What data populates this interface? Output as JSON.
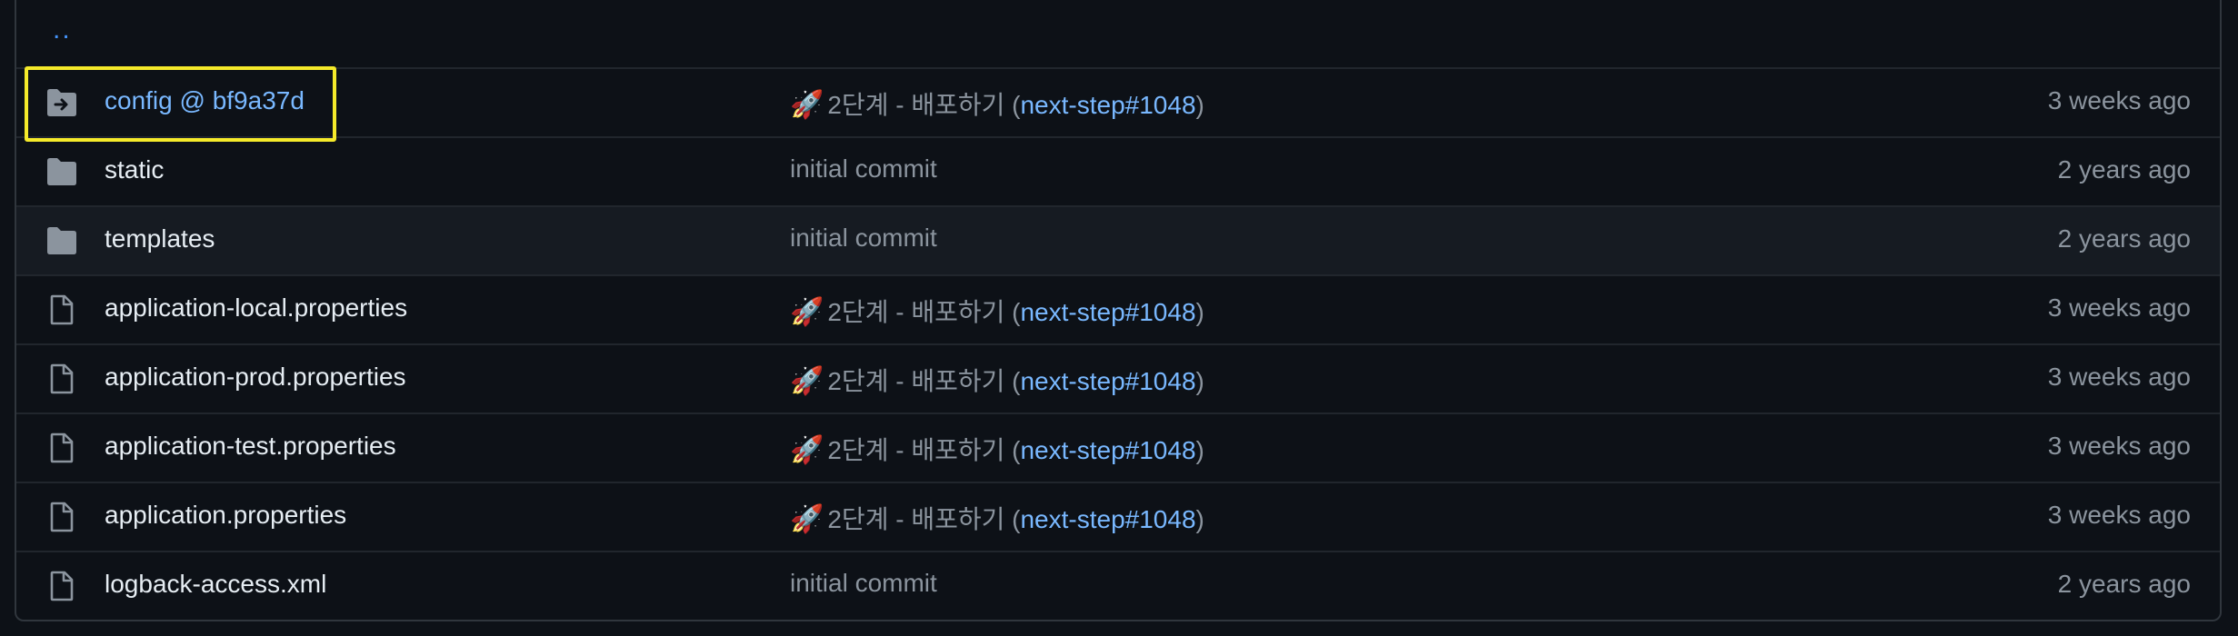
{
  "updir_label": "..",
  "rows": [
    {
      "type": "submodule",
      "name": "config @ bf9a37d",
      "commit_prefix": "2단계 - 배포하기 (",
      "commit_link": "next-step#1048",
      "commit_suffix": ")",
      "age": "3 weeks ago",
      "rocket": true
    },
    {
      "type": "folder",
      "name": "static",
      "commit_prefix": "initial commit",
      "commit_link": "",
      "commit_suffix": "",
      "age": "2 years ago",
      "rocket": false
    },
    {
      "type": "folder",
      "name": "templates",
      "commit_prefix": "initial commit",
      "commit_link": "",
      "commit_suffix": "",
      "age": "2 years ago",
      "rocket": false
    },
    {
      "type": "file",
      "name": "application-local.properties",
      "commit_prefix": "2단계 - 배포하기 (",
      "commit_link": "next-step#1048",
      "commit_suffix": ")",
      "age": "3 weeks ago",
      "rocket": true
    },
    {
      "type": "file",
      "name": "application-prod.properties",
      "commit_prefix": "2단계 - 배포하기 (",
      "commit_link": "next-step#1048",
      "commit_suffix": ")",
      "age": "3 weeks ago",
      "rocket": true
    },
    {
      "type": "file",
      "name": "application-test.properties",
      "commit_prefix": "2단계 - 배포하기 (",
      "commit_link": "next-step#1048",
      "commit_suffix": ")",
      "age": "3 weeks ago",
      "rocket": true
    },
    {
      "type": "file",
      "name": "application.properties",
      "commit_prefix": "2단계 - 배포하기 (",
      "commit_link": "next-step#1048",
      "commit_suffix": ")",
      "age": "3 weeks ago",
      "rocket": true
    },
    {
      "type": "file",
      "name": "logback-access.xml",
      "commit_prefix": "initial commit",
      "commit_link": "",
      "commit_suffix": "",
      "age": "2 years ago",
      "rocket": false
    }
  ],
  "icons": {
    "submodule": "folder-submodule-icon",
    "folder": "folder-icon",
    "file": "file-icon",
    "rocket": "rocket-emoji"
  },
  "colors": {
    "background": "#0d1117",
    "alt_row": "#161b22",
    "link": "#79b8ff",
    "muted": "#8b949e",
    "text": "#e6edf3",
    "highlight": "#f5ea2a"
  }
}
